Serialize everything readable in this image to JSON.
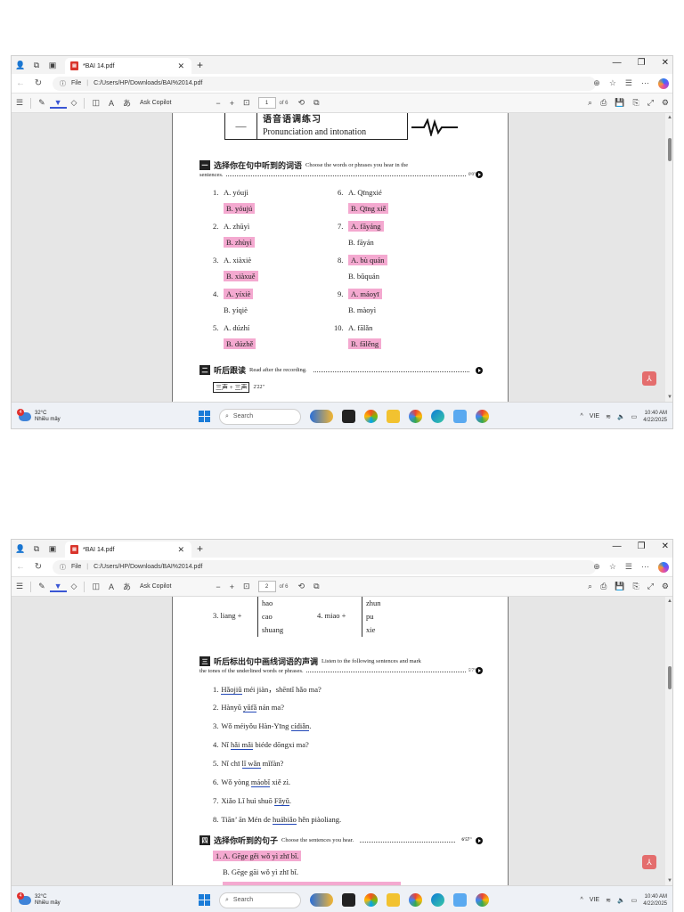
{
  "browser": {
    "tab_title": "*BAI 14.pdf",
    "file_label": "File",
    "url": "C:/Users/HP/Downloads/BAI%2014.pdf",
    "ask_copilot": "Ask Copilot",
    "page_total": "of 6"
  },
  "taskbar": {
    "temp": "32°C",
    "weather": "Nhiều mây",
    "search": "Search",
    "lang": "VIE",
    "time": "10:40 AM",
    "date": "4/22/2025"
  },
  "shot1": {
    "page_num": "1",
    "header": {
      "dash": "—",
      "cn": "语音语调练习",
      "en": "Pronunciation and intonation"
    },
    "section1": {
      "num": "一",
      "cn": "选择你在句中听到的词语",
      "en": "Choose the words or phrases you hear in the",
      "en2": "sentences.",
      "track": "0'0\""
    },
    "items": [
      {
        "n": "1.",
        "a": "A. yóujì",
        "b": "B. yóujú",
        "hl": "b"
      },
      {
        "n": "2.",
        "a": "A. zhūyì",
        "b": "B. zhùyì",
        "hl": "b"
      },
      {
        "n": "3.",
        "a": "A. xiàxiè",
        "b": "B. xiàxuě",
        "hl": "b"
      },
      {
        "n": "4.",
        "a": "A. yíxiè",
        "b": "B. yíqiè",
        "hl": "a"
      },
      {
        "n": "5.",
        "a": "A. dúzhí",
        "b": "B. dúzhě",
        "hl": "b"
      },
      {
        "n": "6.",
        "a": "A. Qīngxié",
        "b": "B. Qīng xiě",
        "hl": "b"
      },
      {
        "n": "7.",
        "a": "A. fāyáng",
        "b": "B. fāyán",
        "hl": "a"
      },
      {
        "n": "8.",
        "a": "A. bù quán",
        "b": "B. bǔquán",
        "hl": "a"
      },
      {
        "n": "9.",
        "a": "A. máoyī",
        "b": "B. màoyì",
        "hl": "a"
      },
      {
        "n": "10.",
        "a": "A. fālǎn",
        "b": "B. fālěng",
        "hl": "b"
      }
    ],
    "section2": {
      "num": "二",
      "cn": "听后跟读",
      "en": "Read after the recording.",
      "sub": "三声 + 三声",
      "time": "2'22\""
    }
  },
  "shot2": {
    "page_num": "2",
    "combo3": {
      "n": "3.",
      "base": "liang +",
      "opts": [
        "hao",
        "cao",
        "shuang"
      ]
    },
    "combo4": {
      "n": "4.",
      "base": "miao +",
      "opts": [
        "zhun",
        "pu",
        "xie"
      ]
    },
    "section3": {
      "num": "三",
      "cn": "听后标出句中画线词语的声调",
      "en": "Listen to the following sentences and mark",
      "en2": "the tones of the underlined words or phrases.",
      "track": "5'7\""
    },
    "sentences": [
      {
        "n": "1.",
        "pre": "",
        "u": "Hǎojiǔ",
        "post": " méi jiàn，shēntǐ hǎo ma?"
      },
      {
        "n": "2.",
        "pre": "Hànyǔ ",
        "u": "yǔfǎ",
        "post": " nán ma?"
      },
      {
        "n": "3.",
        "pre": "Wǒ méiyǒu Hàn-Yīng ",
        "u": "cídiǎn",
        "post": "."
      },
      {
        "n": "4.",
        "pre": "Nǐ ",
        "u": "hǎi mǎi",
        "post": " biéde dōngxi ma?"
      },
      {
        "n": "5.",
        "pre": "Nǐ chī ",
        "u": "lǐ wǎn",
        "post": " mǐfàn?"
      },
      {
        "n": "6.",
        "pre": "Wǒ yòng ",
        "u": "máobǐ",
        "post": " xiě zì."
      },
      {
        "n": "7.",
        "pre": "Xiǎo Lǐ huì shuō ",
        "u": "Fǎyǔ",
        "post": "."
      },
      {
        "n": "8.",
        "pre": "Tiān’ ān Mén de ",
        "u": "huábiǎo",
        "post": " hěn piàoliang."
      }
    ],
    "section4": {
      "num": "四",
      "cn": "选择你听到的句子",
      "en": "Choose the sentences you hear.",
      "track": "6'57\""
    },
    "choices": [
      {
        "text": "1. A. Gēge gěi wǒ yì zhī bǐ.",
        "hl": true
      },
      {
        "text": "B. Gēge gāi wǒ yì zhī bǐ.",
        "hl": false
      }
    ]
  }
}
